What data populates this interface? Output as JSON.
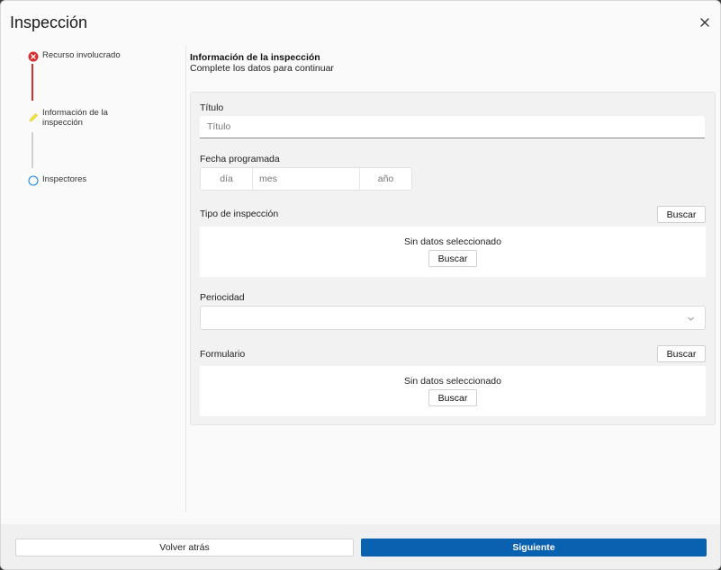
{
  "dialog": {
    "title": "Inspección"
  },
  "stepper": {
    "steps": [
      {
        "label": "Recurso involucrado",
        "state": "error"
      },
      {
        "label": "Información de la inspección",
        "state": "editing"
      },
      {
        "label": "Inspectores",
        "state": "pending"
      }
    ]
  },
  "section": {
    "title": "Información de la inspección",
    "subtitle": "Complete los datos para continuar"
  },
  "form": {
    "titulo": {
      "label": "Título",
      "placeholder": "Título",
      "value": ""
    },
    "fecha": {
      "label": "Fecha programada",
      "day_placeholder": "día",
      "month_placeholder": "mes",
      "year_placeholder": "año"
    },
    "tipo": {
      "label": "Tipo de inspección",
      "search_label": "Buscar",
      "empty_text": "Sin datos seleccionado",
      "empty_button": "Buscar"
    },
    "periodicidad": {
      "label": "Periocidad",
      "value": ""
    },
    "formulario": {
      "label": "Formulario",
      "search_label": "Buscar",
      "empty_text": "Sin datos seleccionado",
      "empty_button": "Buscar"
    }
  },
  "footer": {
    "back_label": "Volver atrás",
    "next_label": "Siguiente"
  },
  "colors": {
    "primary": "#0a61b0",
    "error": "#d32f2f",
    "editing": "#f5e642",
    "pending": "#1e88e5"
  },
  "icons": {
    "close": "close-icon",
    "error": "error-circle-icon",
    "editing": "pencil-icon",
    "pending": "empty-circle-icon",
    "select": "chevron-down-icon"
  }
}
